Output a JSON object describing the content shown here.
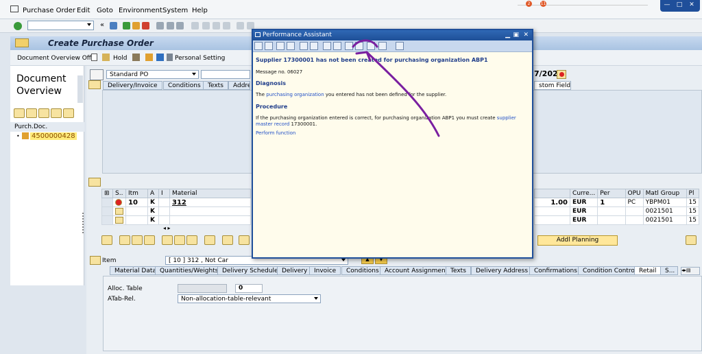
{
  "menubar": {
    "items": [
      "Purchase Order",
      "Edit",
      "Goto",
      "Environment",
      "System",
      "Help"
    ],
    "notif1": "2",
    "notif2": "11"
  },
  "window_controls": {
    "minimize": "—",
    "maximize": "□",
    "close": "✕"
  },
  "title": "Create Purchase Order",
  "appbar": {
    "doc_overview": "Document Overview Off",
    "hold": "Hold",
    "personal_setting": "Personal Setting"
  },
  "leftnav": {
    "title_line1": "Document",
    "title_line2": "Overview",
    "col_header": "Purch.Doc.",
    "doc_number": "4500000428"
  },
  "header": {
    "doc_type": "Standard PO",
    "date_tail": "7/2020",
    "tabs": [
      "Delivery/Invoice",
      "Conditions",
      "Texts",
      "Addres"
    ],
    "custom_fields_tab": "stom Fields"
  },
  "items_table": {
    "columns_left": [
      "S..",
      "Itm",
      "A",
      "I",
      "Material"
    ],
    "columns_right": [
      "Curre...",
      "Per",
      "OPU",
      "Matl Group",
      "Pl"
    ],
    "rows": [
      {
        "itm": "10",
        "a": "K",
        "material": "312",
        "amount": "1.00",
        "curr": "EUR",
        "per": "1",
        "opu": "PC",
        "matl_group": "YBPM01",
        "pl": "15"
      },
      {
        "itm": "",
        "a": "K",
        "material": "",
        "amount": "",
        "curr": "EUR",
        "per": "",
        "opu": "",
        "matl_group": "0021501",
        "pl": "15"
      },
      {
        "itm": "",
        "a": "K",
        "material": "",
        "amount": "",
        "curr": "EUR",
        "per": "",
        "opu": "",
        "matl_group": "0021501",
        "pl": "15"
      }
    ],
    "addl_planning": "Addl Planning"
  },
  "item_detail": {
    "label": "Item",
    "selected": "[ 10 ] 312 , Not Car",
    "tabs": [
      "Material Data",
      "Quantities/Weights",
      "Delivery Schedule",
      "Delivery",
      "Invoice",
      "Conditions",
      "Account Assignment",
      "Texts",
      "Delivery Address",
      "Confirmations",
      "Condition Control",
      "Retail",
      "S..."
    ],
    "alloc_table_label": "Alloc. Table",
    "alloc_table_value": "0",
    "atab_rel_label": "ATab-Rel.",
    "atab_rel_value": "Non-allocation-table-relevant"
  },
  "dialog": {
    "title": "Performance Assistant",
    "heading": "Supplier 17300001 has not been created for purchasing organization ABP1",
    "message_no": "Message no. 06027",
    "diagnosis_h": "Diagnosis",
    "diagnosis_pre": "The ",
    "diagnosis_link": "purchasing organization",
    "diagnosis_post": " you entered has not been defined for the supplier.",
    "procedure_h": "Procedure",
    "procedure_pre": "If the purchasing organization entered is correct, for purchasing organization ABP1 you must create ",
    "procedure_link": "supplier master record",
    "procedure_post": " 17300001.",
    "perform_link": "Perform function"
  },
  "colors": {
    "accent": "#1f4f9a",
    "annotation": "#7a1fa0"
  }
}
